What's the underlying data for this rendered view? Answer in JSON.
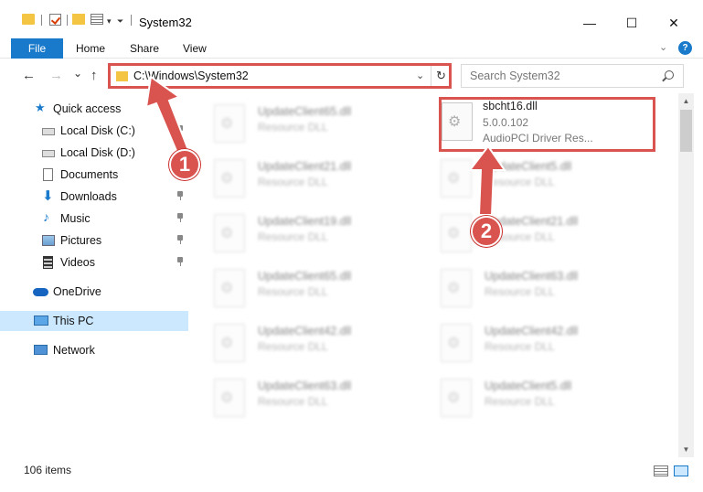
{
  "window": {
    "title": "System32",
    "minimize": "—",
    "maximize": "☐",
    "close": "✕"
  },
  "ribbon": {
    "tabs": [
      "File",
      "Home",
      "Share",
      "View"
    ],
    "expand_icon": "chevron-down-icon",
    "help": "?"
  },
  "nav": {
    "back": "←",
    "forward": "→",
    "recent": "⌄",
    "up": "↑",
    "address": "C:\\Windows\\System32",
    "address_dropdown": "⌄",
    "refresh": "↻",
    "search_placeholder": "Search System32"
  },
  "sidebar": {
    "items": [
      {
        "label": "Quick access",
        "icon": "star-icon"
      },
      {
        "label": "Local Disk (C:)",
        "icon": "drive-icon",
        "pinned": true
      },
      {
        "label": "Local Disk (D:)",
        "icon": "drive-icon",
        "pinned": false
      },
      {
        "label": "Documents",
        "icon": "documents-icon",
        "pinned": false
      },
      {
        "label": "Downloads",
        "icon": "downloads-icon",
        "pinned": true
      },
      {
        "label": "Music",
        "icon": "music-icon",
        "pinned": true
      },
      {
        "label": "Pictures",
        "icon": "pictures-icon",
        "pinned": true
      },
      {
        "label": "Videos",
        "icon": "videos-icon",
        "pinned": true
      },
      {
        "label": "OneDrive",
        "icon": "onedrive-icon"
      },
      {
        "label": "This PC",
        "icon": "computer-icon",
        "selected": true
      },
      {
        "label": "Network",
        "icon": "network-icon"
      }
    ]
  },
  "files": [
    {
      "name": "UpdateClient65.dll",
      "type": "Resource DLL"
    },
    {
      "name": "sbcht16.dll",
      "version": "5.0.0.102",
      "description": "AudioPCI Driver Res..."
    },
    {
      "name": "UpdateClient21.dll",
      "type": "Resource DLL"
    },
    {
      "name": "UpdateClient5.dll",
      "type": "Resource DLL"
    },
    {
      "name": "UpdateClient19.dll",
      "type": "Resource DLL"
    },
    {
      "name": "UpdateClient21.dll",
      "type": "Resource DLL"
    },
    {
      "name": "UpdateClient65.dll",
      "type": "Resource DLL"
    },
    {
      "name": "UpdateClient63.dll",
      "type": "Resource DLL"
    },
    {
      "name": "UpdateClient42.dll",
      "type": "Resource DLL"
    },
    {
      "name": "UpdateClient42.dll",
      "type": "Resource DLL"
    },
    {
      "name": "UpdateClient63.dll",
      "type": "Resource DLL"
    },
    {
      "name": "UpdateClient5.dll",
      "type": "Resource DLL"
    }
  ],
  "status": {
    "count": "106 items"
  },
  "annotations": [
    "1",
    "2"
  ],
  "colors": {
    "accent": "#1979ca",
    "highlight": "#d9534f",
    "selection": "#cce8ff"
  }
}
